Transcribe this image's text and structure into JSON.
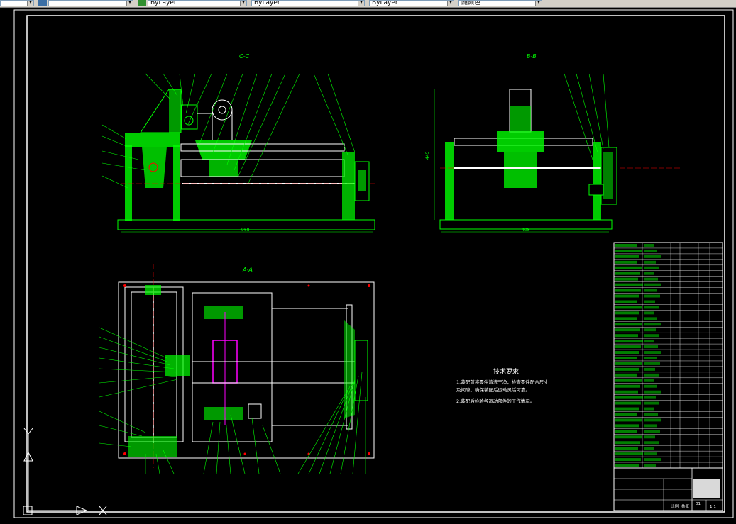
{
  "toolbar": {
    "dropdowns": [
      {
        "value": "ByLayer"
      },
      {
        "value": "ByLayer"
      },
      {
        "value": "ByLayer"
      },
      {
        "value": "随颜色"
      }
    ]
  },
  "views": {
    "cc_label": "C-C",
    "bb_label": "B-B",
    "aa_label": "A-A"
  },
  "dimensions": {
    "cc_width": "968",
    "bb_width": "408",
    "bb_height": "445"
  },
  "notes": {
    "title": "技术要求",
    "line1": "1.装配前将零件清洗干净，检查零件配合尺寸",
    "line2": "及间隙，确保装配后运动灵活可靠。",
    "line3": "2.装配后检验各运动部件的工作情况。"
  },
  "title_block": {
    "scale_label": "比例",
    "sheet_label": "共张",
    "drawing_no": "01",
    "ratio": "1:1"
  },
  "colors": {
    "green": "#00ff00",
    "white": "#ffffff",
    "red": "#ff0000",
    "magenta": "#ff00ff",
    "cyan": "#00ffff"
  }
}
